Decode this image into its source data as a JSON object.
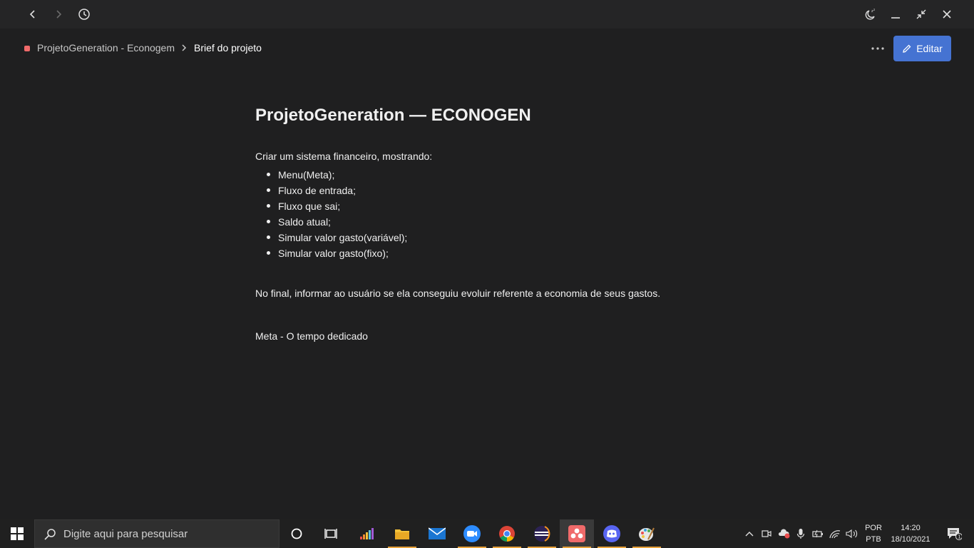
{
  "titlebar": {
    "back_icon": "chevron-left-icon",
    "forward_icon": "chevron-right-icon",
    "history_icon": "clock-icon",
    "snooze_icon": "moon-zzz-icon",
    "minimize_icon": "minimize-icon",
    "restore_icon": "collapse-icon",
    "close_icon": "close-icon"
  },
  "breadcrumb": {
    "project": "ProjetoGeneration - Econogem",
    "current": "Brief do projeto",
    "project_color": "#f06a6a"
  },
  "toolbar": {
    "edit_label": "Editar",
    "accent": "#4573d2"
  },
  "document": {
    "title": "ProjetoGeneration — ECONOGEN",
    "intro": "Criar um sistema financeiro, mostrando:",
    "bullets": [
      "Menu(Meta);",
      "Fluxo de entrada;",
      "Fluxo que sai;",
      "Saldo atual;",
      "Simular valor gasto(variável);",
      "Simular valor gasto(fixo);"
    ],
    "final_paragraph": "No final, informar ao usuário se ela conseguiu evoluir referente a economia de seus gastos.",
    "meta_line": "Meta - O tempo dedicado"
  },
  "taskbar": {
    "search_placeholder": "Digite aqui para pesquisar",
    "apps": [
      "cortana-icon",
      "task-view-icon",
      "deezer-icon",
      "file-explorer-icon",
      "mail-icon",
      "zoom-icon",
      "chrome-icon",
      "eclipse-icon",
      "asana-icon",
      "discord-icon",
      "paint-icon"
    ],
    "language_top": "POR",
    "language_bottom": "PTB",
    "time": "14:20",
    "date": "18/10/2021",
    "notification_count": "1"
  }
}
